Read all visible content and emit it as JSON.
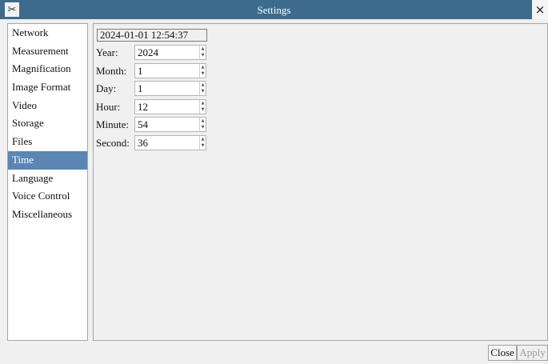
{
  "window": {
    "title": "Settings",
    "app_icon": "tools-icon",
    "close_glyph": "×"
  },
  "sidebar": {
    "items": [
      {
        "label": "Network",
        "selected": false
      },
      {
        "label": "Measurement",
        "selected": false
      },
      {
        "label": "Magnification",
        "selected": false
      },
      {
        "label": "Image Format",
        "selected": false
      },
      {
        "label": "Video",
        "selected": false
      },
      {
        "label": "Storage",
        "selected": false
      },
      {
        "label": "Files",
        "selected": false
      },
      {
        "label": "Time",
        "selected": true
      },
      {
        "label": "Language",
        "selected": false
      },
      {
        "label": "Voice Control",
        "selected": false
      },
      {
        "label": "Miscellaneous",
        "selected": false
      }
    ],
    "selected_color": "#5b86b3"
  },
  "time": {
    "current_datetime": "2024-01-01 12:54:37",
    "fields": [
      {
        "label": "Year:",
        "value": "2024"
      },
      {
        "label": "Month:",
        "value": "1"
      },
      {
        "label": "Day:",
        "value": "1"
      },
      {
        "label": "Hour:",
        "value": "12"
      },
      {
        "label": "Minute:",
        "value": "54"
      },
      {
        "label": "Second:",
        "value": "36"
      }
    ]
  },
  "footer": {
    "close_label": "Close",
    "apply_label": "Apply",
    "apply_enabled": false
  },
  "colors": {
    "titlebar": "#3d6b8e"
  }
}
